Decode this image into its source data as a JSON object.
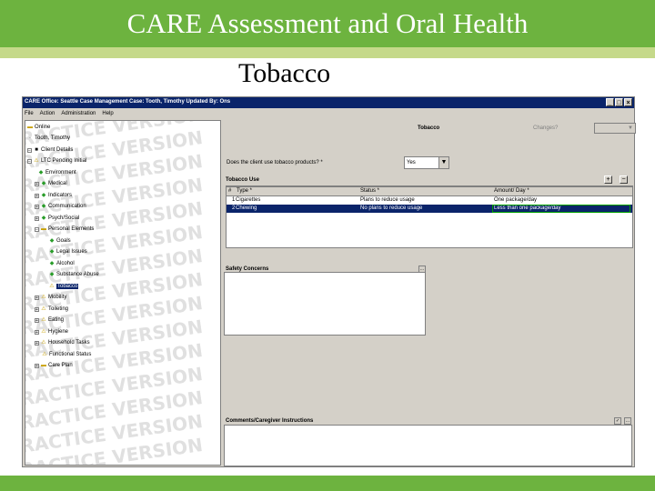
{
  "slide": {
    "title": "CARE Assessment and Oral Health",
    "subtitle": "Tobacco",
    "colors": {
      "band": "#6db33f",
      "rule": "#c5d98a"
    }
  },
  "window": {
    "title": "CARE  Office: Seattle Case Management   Case: Tooth, Timothy   Updated By:  Ons",
    "menu": [
      "File",
      "Action",
      "Administration",
      "Help"
    ]
  },
  "tree": {
    "watermark": "PRACTICE VERSION",
    "items": [
      {
        "label": "Online",
        "icon": "folder-icon"
      },
      {
        "label": "Tooth, Timothy",
        "icon": "person-icon"
      },
      {
        "label": "Client Details",
        "icon": "square-icon"
      },
      {
        "label": "LTC Pending Initial",
        "icon": "warning-icon"
      },
      {
        "label": "Environment",
        "icon": "diamond-icon"
      },
      {
        "label": "Medical",
        "icon": "diamond-icon"
      },
      {
        "label": "Indicators",
        "icon": "diamond-icon"
      },
      {
        "label": "Communication",
        "icon": "diamond-icon"
      },
      {
        "label": "Psych/Social",
        "icon": "diamond-icon"
      },
      {
        "label": "Personal Elements",
        "icon": "folder-icon"
      },
      {
        "label": "Goals",
        "icon": "diamond-icon"
      },
      {
        "label": "Legal Issues",
        "icon": "diamond-icon"
      },
      {
        "label": "Alcohol",
        "icon": "diamond-icon"
      },
      {
        "label": "Substance Abuse",
        "icon": "diamond-icon"
      },
      {
        "label": "Tobacco",
        "icon": "warning-icon"
      },
      {
        "label": "Mobility",
        "icon": "warning-icon"
      },
      {
        "label": "Toileting",
        "icon": "warning-icon"
      },
      {
        "label": "Eating",
        "icon": "warning-icon"
      },
      {
        "label": "Hygiene",
        "icon": "warning-icon"
      },
      {
        "label": "Household Tasks",
        "icon": "warning-icon"
      },
      {
        "label": "Functional Status",
        "icon": "warning-icon"
      },
      {
        "label": "Care Plan",
        "icon": "folder-icon"
      }
    ]
  },
  "form": {
    "title": "Tobacco",
    "changes_label": "Changes?",
    "question": "Does the client use tobacco products? *",
    "question_value": "Yes",
    "tobacco_use": {
      "heading": "Tobacco Use",
      "add": "+",
      "remove": "−",
      "columns": [
        "#",
        "Type *",
        "Status *",
        "Amount/ Day *"
      ],
      "rows": [
        [
          "1",
          "Cigarettes",
          "Plans to reduce usage",
          "One package/day"
        ],
        [
          "2",
          "Chewing",
          "No plans to reduce usage",
          "Less than one package/day"
        ]
      ]
    },
    "safety_heading": "Safety Concerns",
    "comments_heading": "Comments/Caregiver Instructions",
    "ellipsis": "..."
  }
}
